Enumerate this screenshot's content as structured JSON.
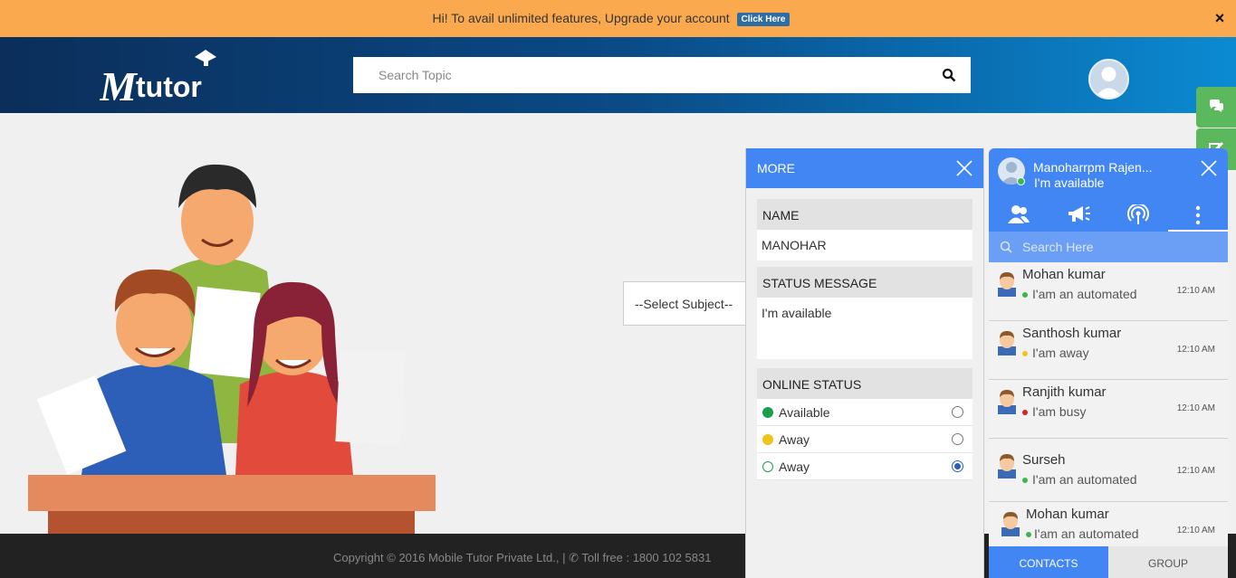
{
  "promo": {
    "text": "Hi! To avail unlimited features, Upgrade your account",
    "button": "Click Here",
    "close": "×"
  },
  "header": {
    "logo_text": "Mtutor",
    "search_placeholder": "Search Topic"
  },
  "main": {
    "select_subject": "--Select Subject--"
  },
  "footer": {
    "text": "Copyright © 2016 Mobile Tutor Private Ltd., | ✆ Toll free : 1800 102 5831"
  },
  "more_panel": {
    "title": "MORE",
    "name_label": "NAME",
    "name_value": "MANOHAR",
    "status_message_label": "STATUS MESSAGE",
    "status_message_value": "I'm available",
    "online_status_label": "ONLINE STATUS",
    "statuses": [
      {
        "label": "Available",
        "color": "#1a9e4b",
        "selected": false
      },
      {
        "label": "Away",
        "color": "#f0c419",
        "selected": false
      },
      {
        "label": "Away",
        "color": "#ffffff",
        "selected": true
      }
    ]
  },
  "chat": {
    "user_name": "Manoharrpm Rajen...",
    "user_status": "I'm available",
    "search_placeholder": "Search Here",
    "contacts": [
      {
        "name": "Mohan kumar",
        "message": "I'am an automated",
        "time": "12:10 AM",
        "status_color": "#3cb84a"
      },
      {
        "name": "Santhosh kumar",
        "message": "I'am away",
        "time": "12:10 AM",
        "status_color": "#f0c419"
      },
      {
        "name": "Ranjith kumar",
        "message": "I'am busy",
        "time": "12:10 AM",
        "status_color": "#e02020"
      },
      {
        "name": "Surseh",
        "message": "I'am an automated",
        "time": "12:10 AM",
        "status_color": "#3cb84a"
      },
      {
        "name": "Mohan kumar",
        "message": "I'am an automated",
        "time": "12:10 AM",
        "status_color": "#3cb84a"
      }
    ],
    "bottom_tabs": [
      "CONTACTS",
      "GROUP"
    ]
  }
}
